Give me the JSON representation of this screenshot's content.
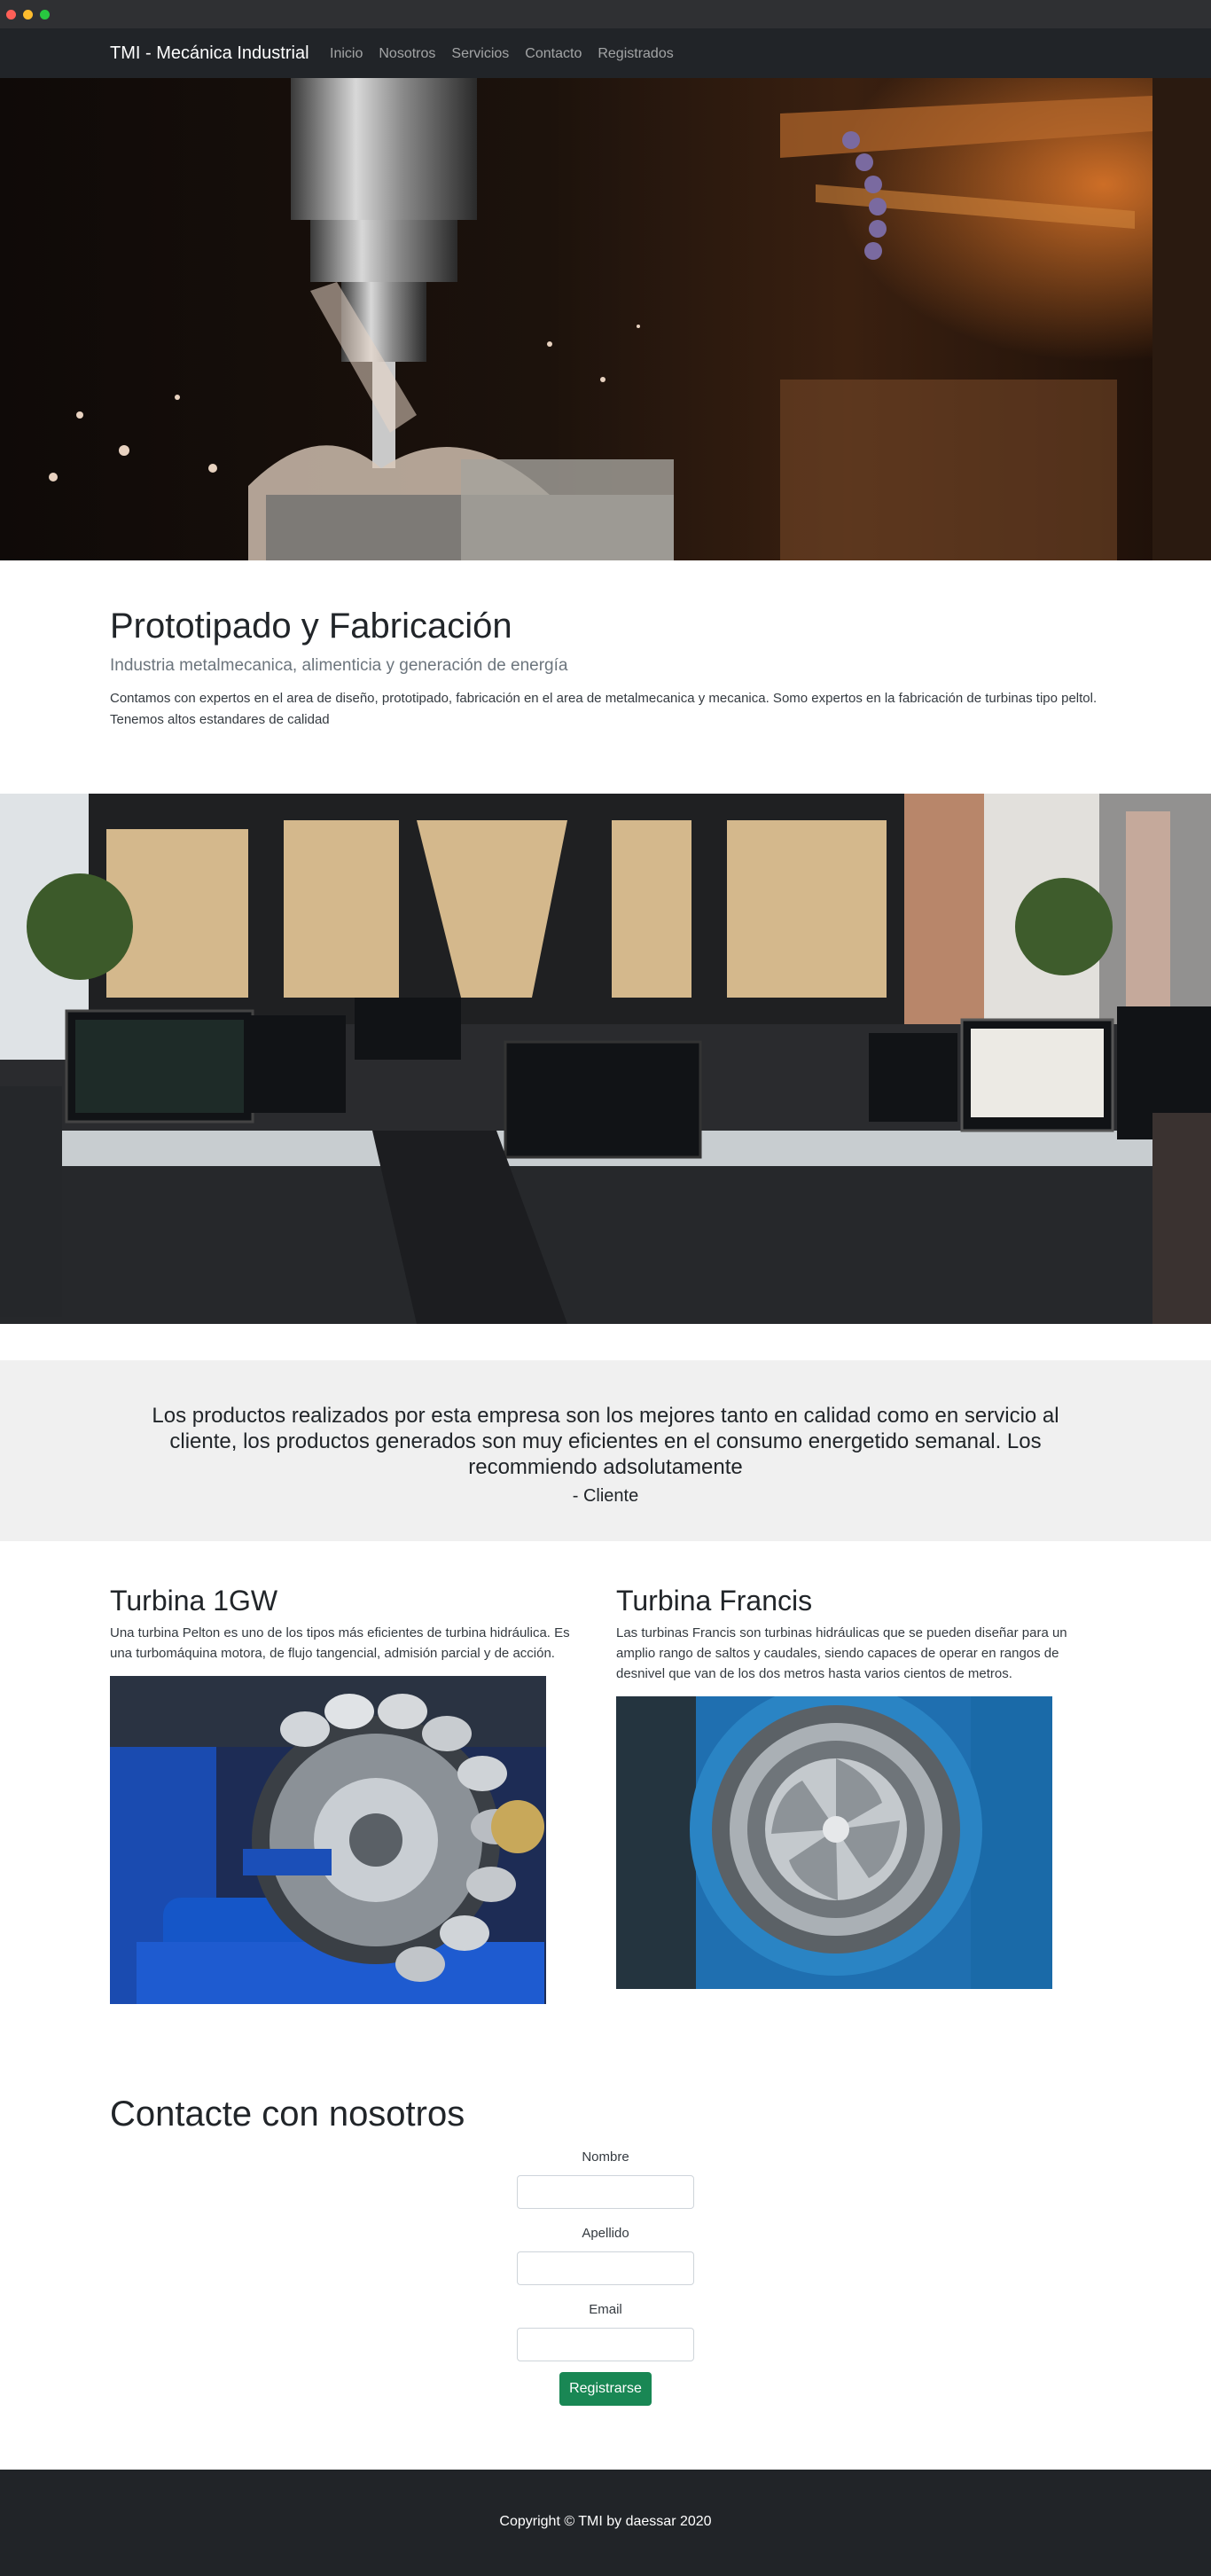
{
  "navbar": {
    "brand": "TMI - Mecánica Industrial",
    "links": [
      "Inicio",
      "Nosotros",
      "Servicios",
      "Contacto",
      "Registrados"
    ]
  },
  "intro": {
    "title": "Prototipado y Fabricación",
    "lead": "Industria metalmecanica, alimenticia y generación de energía",
    "body": "Contamos con expertos en el area de diseño, prototipado, fabricación en el area de metalmecanica y mecanica. Somo expertos en la fabricación de turbinas tipo peltol. Tenemos altos estandares de calidad"
  },
  "testimonial": {
    "quote": "Los productos realizados por esta empresa son los mejores tanto en calidad como en servicio al cliente, los productos generados son muy eficientes en el consumo energetido semanal. Los recommiendo adsolutamente",
    "author": "- Cliente"
  },
  "products": [
    {
      "title": "Turbina 1GW",
      "description": "Una turbina Pelton es uno de los tipos más eficientes de turbina hidráulica. Es una turbomáquina motora, de flujo tangencial, admisión parcial y de acción."
    },
    {
      "title": "Turbina Francis",
      "description": "Las turbinas Francis son turbinas hidráulicas que se pueden diseñar para un amplio rango de saltos y caudales, siendo capaces de operar en rangos de desnivel que van de los dos metros hasta varios cientos de metros."
    }
  ],
  "contact": {
    "title": "Contacte con nosotros",
    "fields": [
      {
        "label": "Nombre",
        "value": ""
      },
      {
        "label": "Apellido",
        "value": ""
      },
      {
        "label": "Email",
        "value": ""
      }
    ],
    "submit_label": "Registrarse"
  },
  "footer": {
    "text": "Copyright © TMI by daessar 2020"
  },
  "colors": {
    "navbar_bg": "#212428",
    "submit_bg": "#198754",
    "testimonial_bg": "#f0f0f0"
  }
}
